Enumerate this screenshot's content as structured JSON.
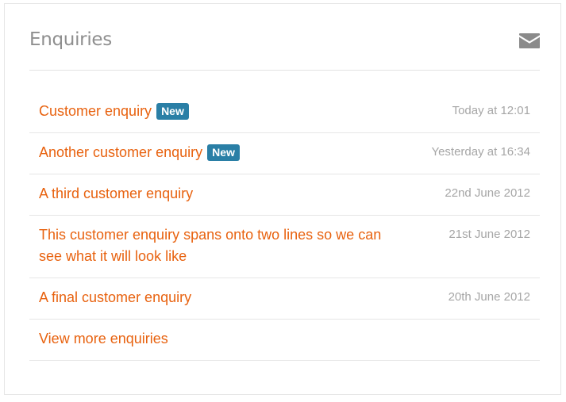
{
  "panel": {
    "title": "Enquiries",
    "header_icon": "envelope-icon"
  },
  "enquiries": [
    {
      "title": "Customer enquiry",
      "badge": "New",
      "date": "Today at 12:01"
    },
    {
      "title": "Another customer enquiry",
      "badge": "New",
      "date": "Yesterday at 16:34"
    },
    {
      "title": "A third customer enquiry",
      "date": "22nd June 2012"
    },
    {
      "title": "This customer enquiry spans onto two lines so we can see what it will look like",
      "date": "21st June 2012"
    },
    {
      "title": "A final customer enquiry",
      "date": "20th June 2012"
    }
  ],
  "view_more_label": "View more enquiries",
  "colors": {
    "link": "#e8620f",
    "badge_bg": "#2a7fa6",
    "date_text": "#a6a6a6",
    "title_text": "#8f8f8f"
  }
}
